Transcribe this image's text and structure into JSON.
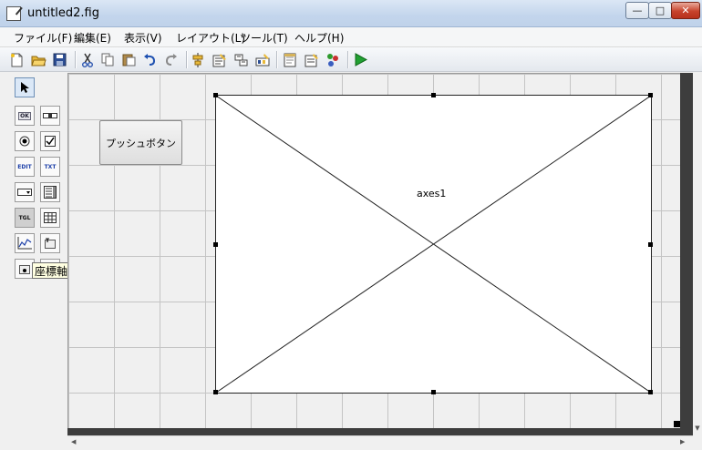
{
  "window": {
    "title": "untitled2.fig",
    "min_glyph": "—",
    "max_glyph": "□",
    "close_glyph": "✕"
  },
  "menu": {
    "items": [
      "ファイル(F)",
      "編集(E)",
      "表示(V)",
      "レイアウト(L)",
      "ツール(T)",
      "ヘルプ(H)"
    ]
  },
  "toolbar": {
    "icons": [
      "new-file-icon",
      "open-folder-icon",
      "save-icon",
      "cut-icon",
      "copy-icon",
      "paste-icon",
      "undo-icon",
      "redo-icon",
      "align-icon",
      "menu-editor-icon",
      "tab-order-icon",
      "toolbar-editor-icon",
      "mfile-editor-icon",
      "property-inspector-icon",
      "object-browser-icon",
      "run-icon"
    ]
  },
  "palette": {
    "buttons": [
      {
        "name": "select-tool",
        "label": ""
      },
      {
        "name": "push-button-tool",
        "label": "OK"
      },
      {
        "name": "slider-tool",
        "label": ""
      },
      {
        "name": "radio-button-tool",
        "label": ""
      },
      {
        "name": "checkbox-tool",
        "label": ""
      },
      {
        "name": "edit-text-tool",
        "label": "EDIT"
      },
      {
        "name": "static-text-tool",
        "label": "TXT"
      },
      {
        "name": "popup-menu-tool",
        "label": ""
      },
      {
        "name": "listbox-tool",
        "label": ""
      },
      {
        "name": "toggle-button-tool",
        "label": "TGL"
      },
      {
        "name": "table-tool",
        "label": ""
      },
      {
        "name": "axes-tool",
        "label": ""
      },
      {
        "name": "panel-tool",
        "label": ""
      },
      {
        "name": "button-group-tool",
        "label": ""
      },
      {
        "name": "activex-tool",
        "label": ""
      }
    ],
    "tooltip": "座標軸"
  },
  "canvas": {
    "push_button_label": "プッシュボタン",
    "axes_label": "axes1"
  }
}
